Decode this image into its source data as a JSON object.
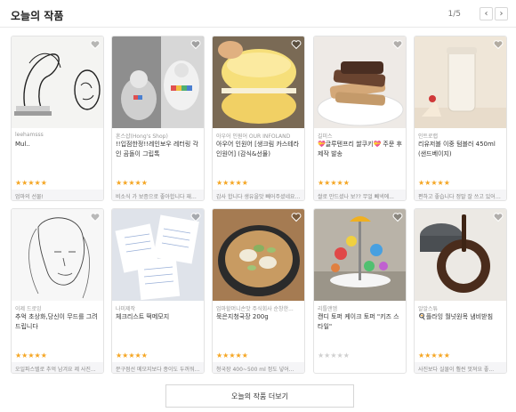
{
  "header": {
    "title": "오늘의 작품",
    "pager": "1/5"
  },
  "more_button": "오늘의 작품 더보기",
  "products": [
    {
      "artist": "leehamsss",
      "name": "Mul..",
      "stars": "★★★★★",
      "rated": true,
      "review": "엄마의 선물!"
    },
    {
      "artist": "혼스샵(Hong's Shop)",
      "name": "!!입점한정!!레인보우 레터링 각인 곰돌이 그립톡",
      "stars": "★★★★★",
      "rated": true,
      "review": "비소식 가 보증으로 좋아합니다 재주문..."
    },
    {
      "artist": "아우어 인원어 OUR INFOLAND",
      "name": "아우어 인원어 [생크림 카스테라 인원어] (감식&선물)",
      "stars": "★★★★★",
      "rated": true,
      "review": "감사 합니다 생유을맛 빼어주셨네요..."
    },
    {
      "artist": "길미스",
      "name": "💝글루텐프리 쌀쿠키💝 주문 후 제작 발송",
      "stars": "★★★★★",
      "rated": true,
      "review": "쌀로 만드셨나 보?? 무얼 빼넥에..."
    },
    {
      "artist": "인트로랩",
      "name": "리유저블 이중 텀블러 450ml (샌드베이지)",
      "stars": "★★★★★",
      "rated": true,
      "review": "편하고 좋습니다 정말 잘 쓰고 있어요..."
    },
    {
      "artist": "이제 드로잉",
      "name": "추억 초상화,당신이 무드를 그려드립니다",
      "stars": "★★★★★",
      "rated": true,
      "review": "오일파스텔로 추억 남겨요 제 사진..."
    },
    {
      "artist": "나미제작",
      "name": "체크리스트 떡메모지",
      "stars": "★★★★★",
      "rated": true,
      "review": "문구점선 메모지보다 종이도 두꺼워요..."
    },
    {
      "artist": "엄마할머니손맛 주식회사 순창한...",
      "name": "묵은지청국장 200g",
      "stars": "★★★★★",
      "rated": true,
      "review": "청국장 400~500 ml 정도 넣어..."
    },
    {
      "artist": "리틀앤엠",
      "name": "캔디 토퍼 케이크 토퍼 \"키즈 스타일\"",
      "stars": "★★★★★",
      "rated": false,
      "review": ""
    },
    {
      "artist": "알알스튜",
      "name": "🍳플라잉 월넛원목 냄비받침",
      "stars": "★★★★★",
      "rated": true,
      "review": "사진보다 실물이 훨씬 멋져요 좋..."
    }
  ]
}
